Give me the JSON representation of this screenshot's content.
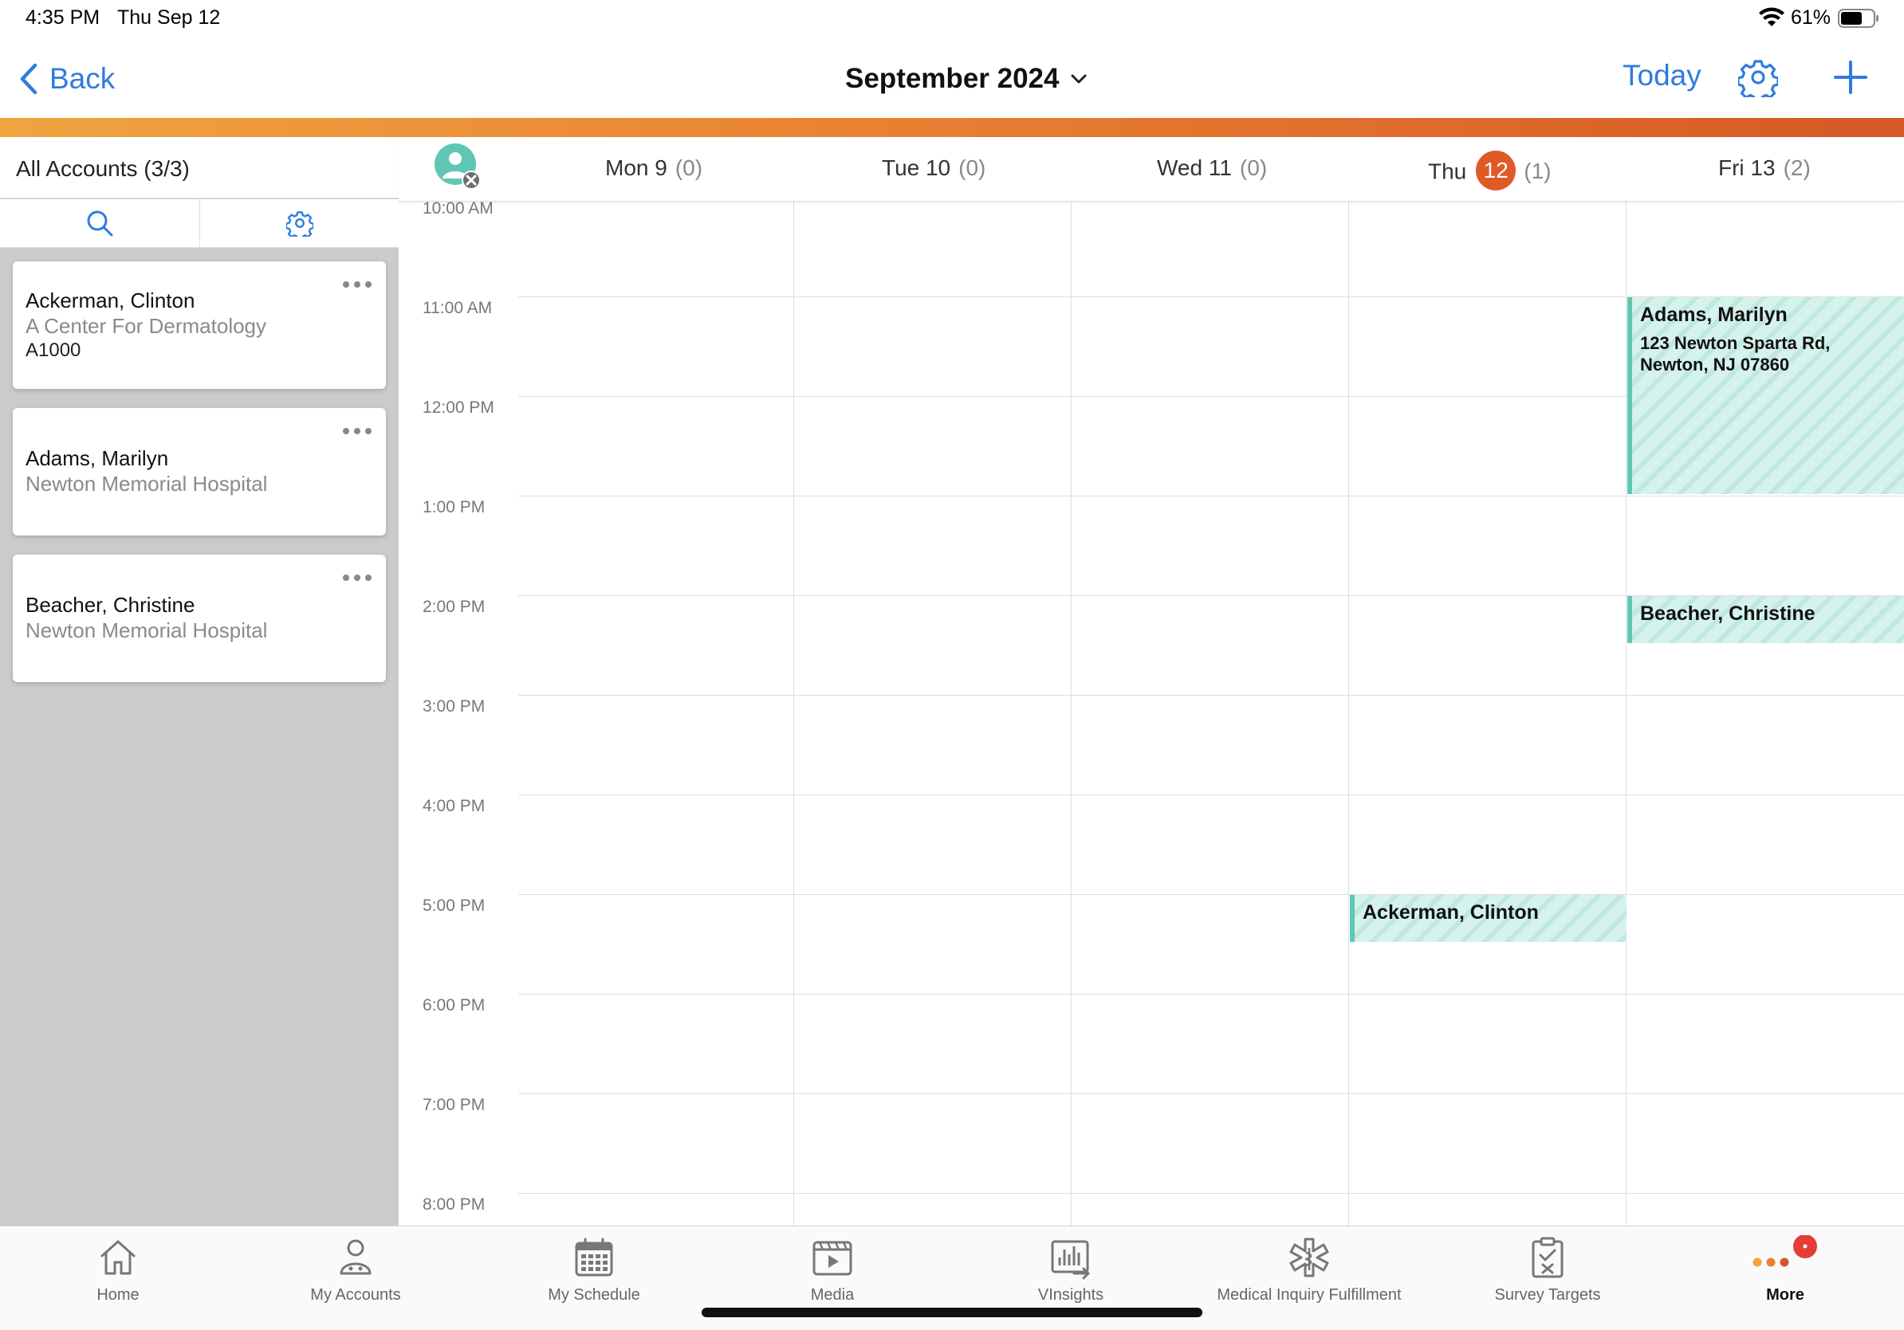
{
  "status_bar": {
    "time": "4:35 PM",
    "date": "Thu Sep 12",
    "battery": "61%"
  },
  "nav": {
    "back_label": "Back",
    "title": "September 2024",
    "today_label": "Today"
  },
  "accounts_panel": {
    "title": "All Accounts (3/3)",
    "cards": [
      {
        "name": "Ackerman, Clinton",
        "organization": "A Center For Dermatology",
        "code": "A1000"
      },
      {
        "name": "Adams, Marilyn",
        "organization": "Newton Memorial Hospital"
      },
      {
        "name": "Beacher, Christine",
        "organization": "Newton Memorial Hospital"
      }
    ]
  },
  "calendar": {
    "days": [
      {
        "label": "Mon 9",
        "count": "(0)"
      },
      {
        "label": "Tue 10",
        "count": "(0)"
      },
      {
        "label": "Wed 11",
        "count": "(0)"
      },
      {
        "label": "Thu",
        "day_number": "12",
        "count": "(1)",
        "is_today": true
      },
      {
        "label": "Fri 13",
        "count": "(2)"
      }
    ],
    "time_labels": [
      "10:00 AM",
      "11:00 AM",
      "12:00 PM",
      "1:00 PM",
      "2:00 PM",
      "3:00 PM",
      "4:00 PM",
      "5:00 PM",
      "6:00 PM",
      "7:00 PM",
      "8:00 PM"
    ],
    "events": [
      {
        "title": "Adams, Marilyn",
        "address_line1": "123 Newton Sparta Rd,",
        "address_line2": "Newton, NJ 07860"
      },
      {
        "title": "Beacher, Christine"
      },
      {
        "title": "Ackerman, Clinton"
      }
    ],
    "colors": {
      "event_fill": "#d6f2ec",
      "event_border": "#5fc7b4",
      "today_badge": "#e05a27"
    }
  },
  "tab_bar": {
    "items": [
      {
        "label": "Home",
        "icon": "home-icon"
      },
      {
        "label": "My Accounts",
        "icon": "accounts-icon"
      },
      {
        "label": "My Schedule",
        "icon": "calendar-icon"
      },
      {
        "label": "Media",
        "icon": "media-icon"
      },
      {
        "label": "VInsights",
        "icon": "insights-chart-icon"
      },
      {
        "label": "Medical Inquiry Fulfillment",
        "icon": "medical-star-icon"
      },
      {
        "label": "Survey Targets",
        "icon": "clipboard-check-icon"
      },
      {
        "label": "More",
        "icon": "more-dots-icon",
        "active": true
      }
    ]
  },
  "theme": {
    "accent_blue": "#2f7be0",
    "accent_orange_start": "#f0a440",
    "accent_orange_end": "#d65825"
  }
}
